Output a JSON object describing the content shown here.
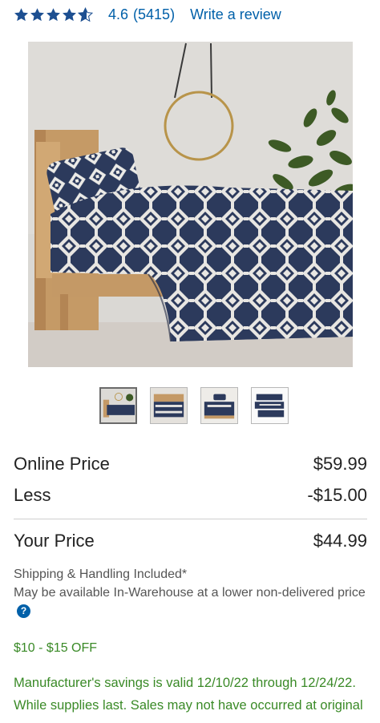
{
  "rating": {
    "value": "4.6",
    "count": "(5415)",
    "stars_filled": 4.6,
    "write_review_label": "Write a review"
  },
  "gallery": {
    "thumbnail_count": 4,
    "selected_index": 0
  },
  "pricing": {
    "online_label": "Online Price",
    "online_value": "$59.99",
    "less_label": "Less",
    "less_value": "-$15.00",
    "your_label": "Your Price",
    "your_value": "$44.99"
  },
  "shipping": {
    "line1": "Shipping & Handling Included*",
    "line2": "May be available In-Warehouse at a lower non-delivered price",
    "help_icon": "question-circle-icon"
  },
  "promo": {
    "badge": "$10 - $15 OFF",
    "savings_text": "Manufacturer's savings is valid 12/10/22 through 12/24/22. While supplies last. Sales may not have occurred at original"
  },
  "colors": {
    "link_blue": "#0060a9",
    "star_blue": "#1d4f91",
    "promo_green": "#3a8a27",
    "sheet_navy": "#2c3a5c"
  }
}
